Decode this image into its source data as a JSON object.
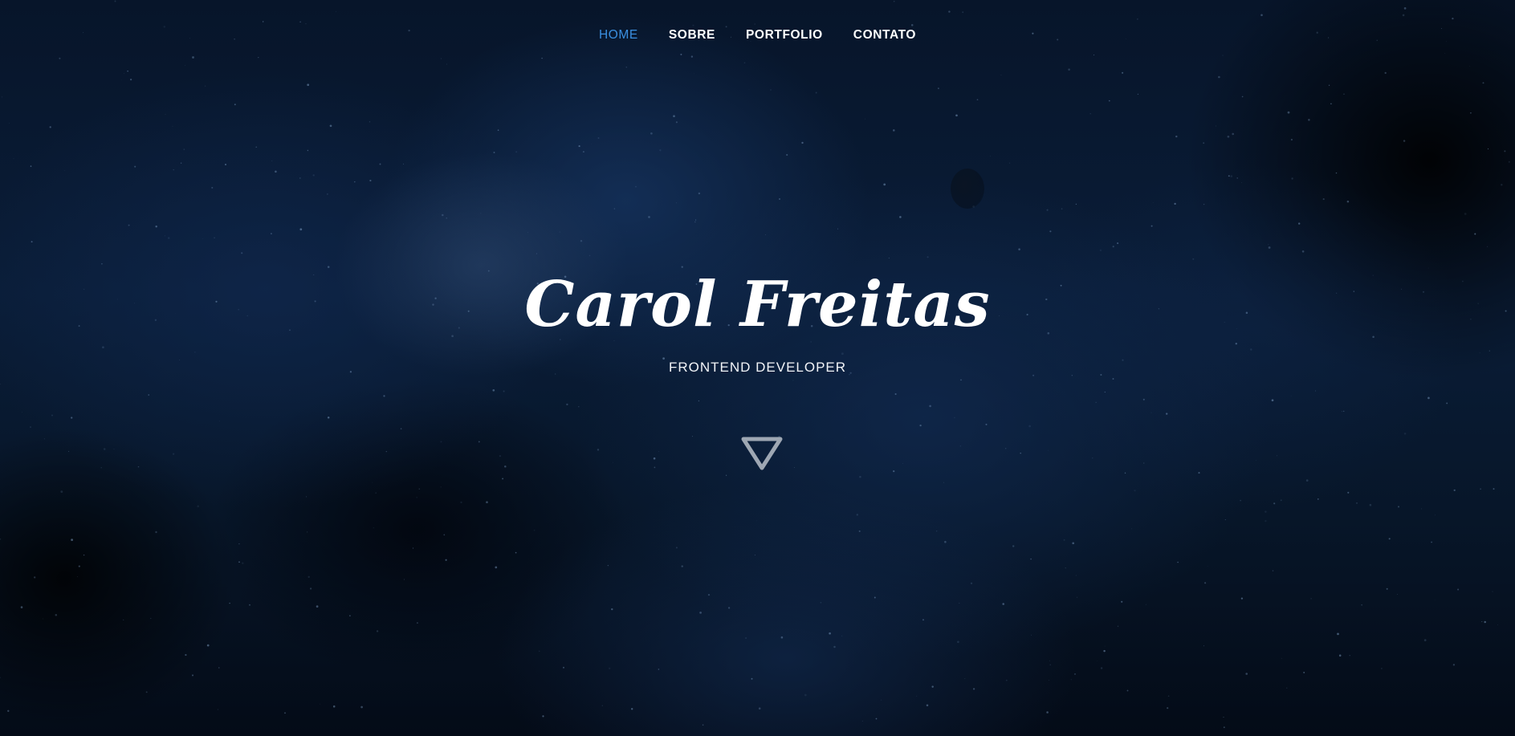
{
  "nav": {
    "items": [
      {
        "label": "HOME",
        "active": true
      },
      {
        "label": "SOBRE",
        "active": false
      },
      {
        "label": "PORTFOLIO",
        "active": false
      },
      {
        "label": "CONTATO",
        "active": false
      }
    ]
  },
  "hero": {
    "title": "Carol Freitas",
    "subtitle": "FRONTEND DEVELOPER",
    "scroll_icon": "triangle-down-icon"
  },
  "colors": {
    "accent": "#3a8fe0",
    "text": "#ffffff",
    "background": "#0a1d38",
    "scroll_icon": "#9ea7b3"
  }
}
